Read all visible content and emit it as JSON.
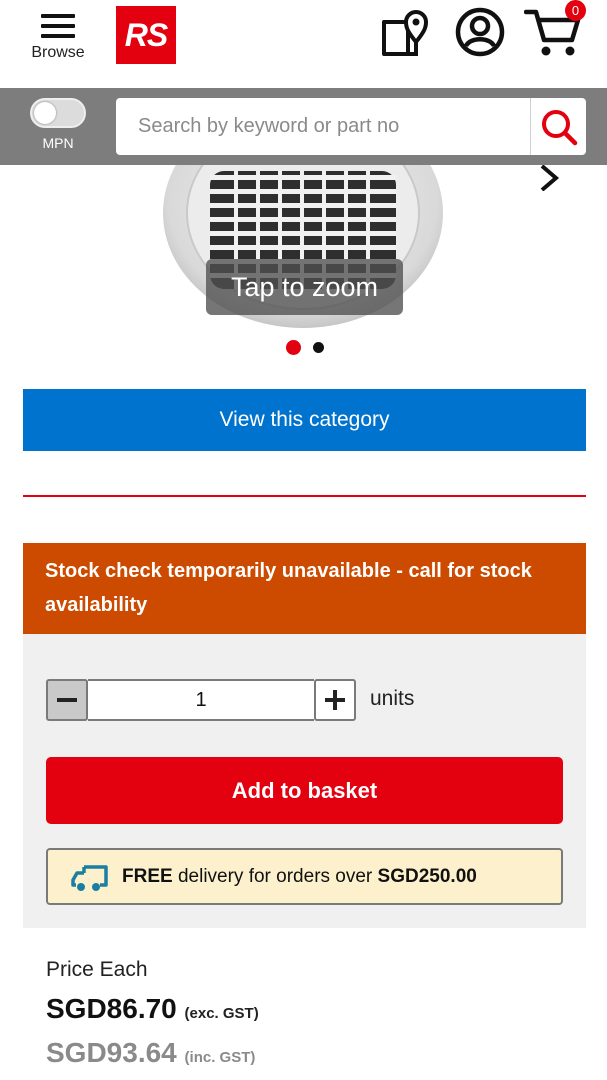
{
  "header": {
    "browse_label": "Browse",
    "logo_text": "RS",
    "cart_count": "0",
    "icons": [
      "menu-icon",
      "store-locator-icon",
      "account-icon",
      "cart-icon"
    ]
  },
  "search": {
    "toggle_label": "MPN",
    "placeholder": "Search by keyword or part no",
    "icon": "search-icon"
  },
  "carousel": {
    "zoom_tip": "Tap to zoom",
    "slide_count": 2,
    "active_slide": 1
  },
  "category_button": "View this category",
  "stock_message": "Stock check temporarily unavailable - call for stock availability",
  "purchase": {
    "quantity": "1",
    "units_label": "units",
    "add_to_basket": "Add to basket",
    "delivery": {
      "free": "FREE",
      "text": " delivery for orders over ",
      "threshold": "SGD250.00"
    }
  },
  "price": {
    "label": "Price Each",
    "exc_value": "SGD86.70",
    "exc_note": "(exc. GST)",
    "inc_value": "SGD93.64",
    "inc_note": "(inc. GST)"
  },
  "colors": {
    "brand_red": "#e3000f",
    "category_blue": "#0073cf",
    "stock_orange": "#cc4b00",
    "delivery_bg": "#fdf1cd"
  }
}
